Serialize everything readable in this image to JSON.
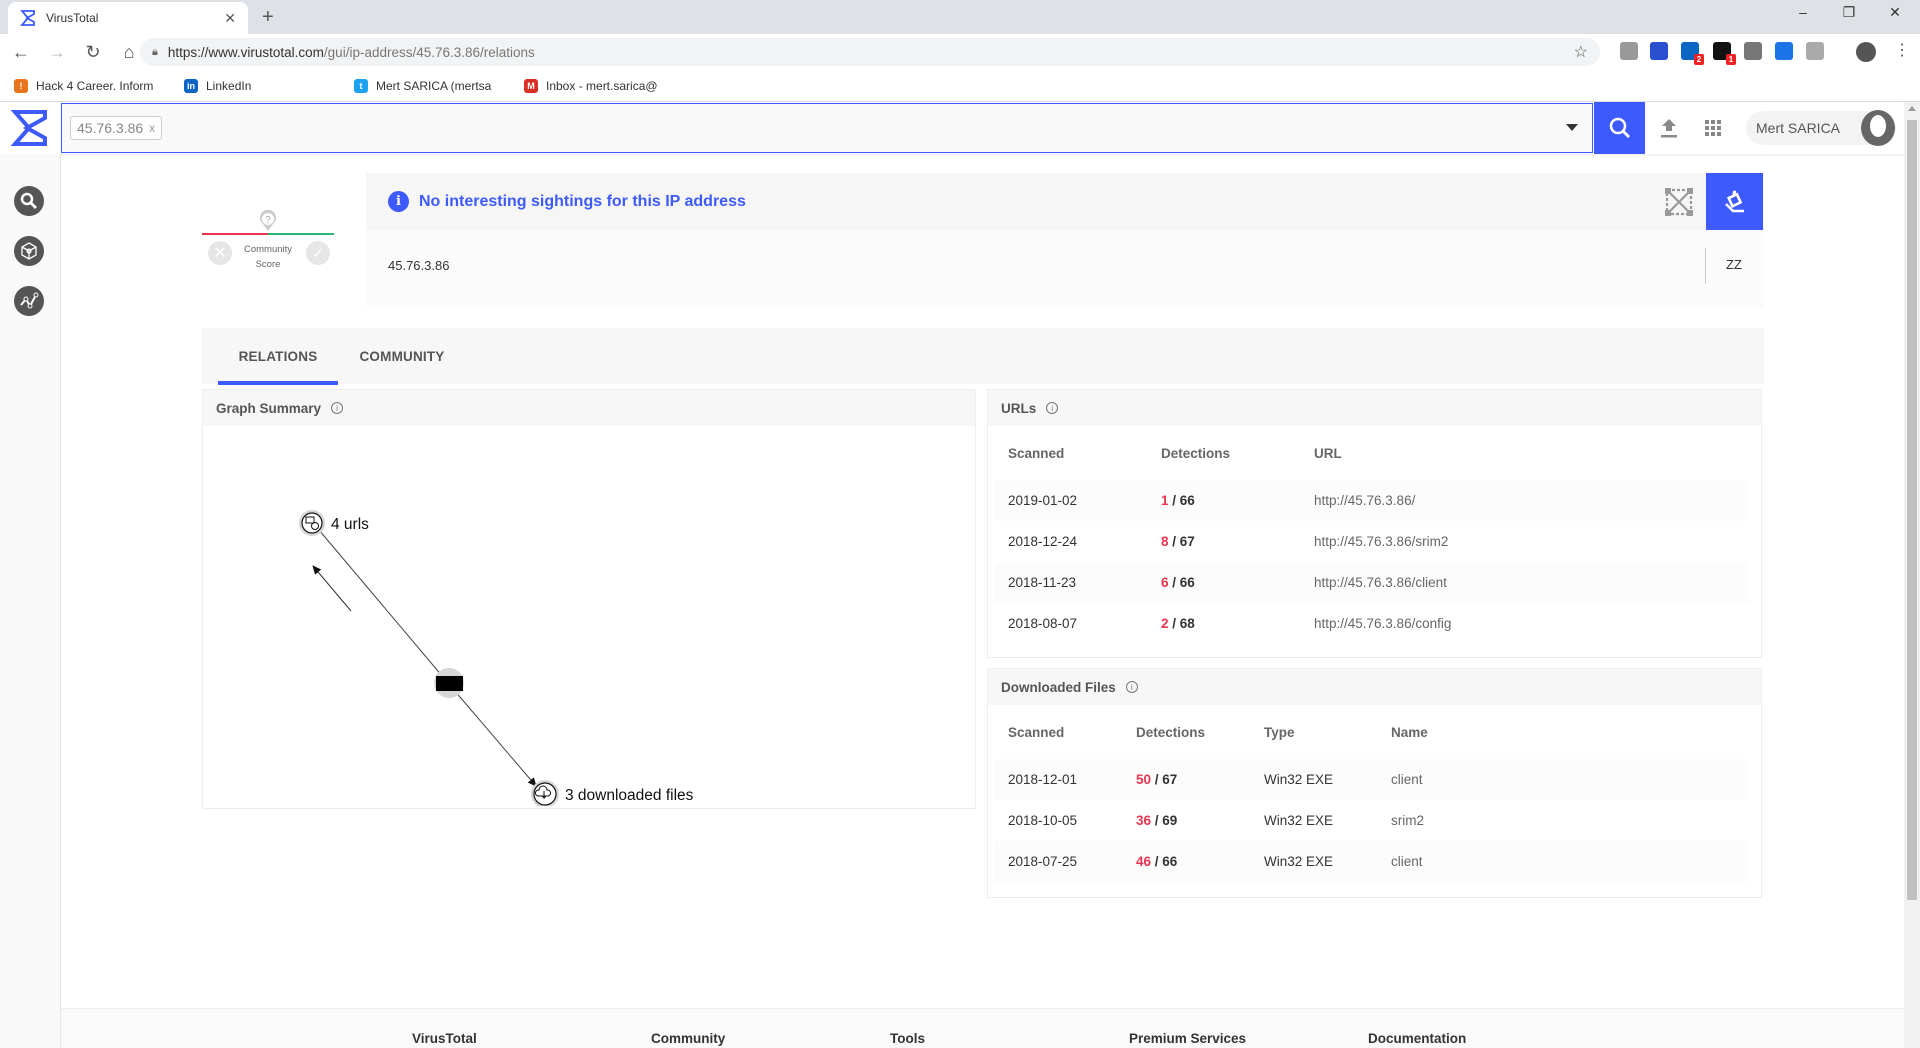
{
  "browser": {
    "tab_title": "VirusTotal",
    "new_tab": "+",
    "window_controls": {
      "minimize": "–",
      "maximize": "❐",
      "close": "✕"
    },
    "url_host": "https://www.virustotal.com",
    "url_path": "/gui/ip-address/45.76.3.86/relations",
    "extensions": [
      {
        "name": "globe",
        "color": "#999999",
        "badge": ""
      },
      {
        "name": "block",
        "color": "#2a4fd0",
        "badge": ""
      },
      {
        "name": "linkedin",
        "color": "#0a66c2",
        "badge": "2"
      },
      {
        "name": "dark",
        "color": "#111111",
        "badge": "1"
      },
      {
        "name": "s",
        "color": "#777777",
        "badge": ""
      },
      {
        "name": "arrow",
        "color": "#1a73e8",
        "badge": ""
      },
      {
        "name": "shield",
        "color": "#aaaaaa",
        "badge": ""
      }
    ],
    "bookmarks": [
      {
        "label": "Hack 4 Career. Inform",
        "icon": "h4c-icon",
        "color": "#e8741c",
        "glyph": "!"
      },
      {
        "label": "LinkedIn",
        "icon": "linkedin-icon",
        "color": "#0a66c2",
        "glyph": "in"
      },
      {
        "label": "Mert SARICA (mertsa",
        "icon": "twitter-icon",
        "color": "#1da1f2",
        "glyph": "t"
      },
      {
        "label": "Inbox - mert.sarica@",
        "icon": "gmail-icon",
        "color": "#d93025",
        "glyph": "M"
      }
    ]
  },
  "header": {
    "search_chip": "45.76.3.86",
    "chip_close": "x",
    "user_name": "Mert SARICA"
  },
  "summary": {
    "community_score_label_1": "Community",
    "community_score_label_2": "Score",
    "message": "No interesting sightings for this IP address",
    "ip": "45.76.3.86",
    "tag": "ZZ"
  },
  "tabs": [
    {
      "label": "RELATIONS",
      "active": true
    },
    {
      "label": "COMMUNITY",
      "active": false
    }
  ],
  "graph": {
    "title": "Graph Summary",
    "nodes": [
      {
        "id": "urls",
        "label": "4 urls"
      },
      {
        "id": "files",
        "label": "3 downloaded files"
      }
    ]
  },
  "urls": {
    "title": "URLs",
    "columns": [
      "Scanned",
      "Detections",
      "URL"
    ],
    "rows": [
      {
        "scanned": "2019-01-02",
        "positives": "1",
        "total": "66",
        "url": "http://45.76.3.86/"
      },
      {
        "scanned": "2018-12-24",
        "positives": "8",
        "total": "67",
        "url": "http://45.76.3.86/srim2"
      },
      {
        "scanned": "2018-11-23",
        "positives": "6",
        "total": "66",
        "url": "http://45.76.3.86/client"
      },
      {
        "scanned": "2018-08-07",
        "positives": "2",
        "total": "68",
        "url": "http://45.76.3.86/config"
      }
    ]
  },
  "files": {
    "title": "Downloaded Files",
    "columns": [
      "Scanned",
      "Detections",
      "Type",
      "Name"
    ],
    "rows": [
      {
        "scanned": "2018-12-01",
        "positives": "50",
        "total": "67",
        "type": "Win32 EXE",
        "name": "client"
      },
      {
        "scanned": "2018-10-05",
        "positives": "36",
        "total": "69",
        "type": "Win32 EXE",
        "name": "srim2"
      },
      {
        "scanned": "2018-07-25",
        "positives": "46",
        "total": "66",
        "type": "Win32 EXE",
        "name": "client"
      }
    ]
  },
  "footer": [
    "VirusTotal",
    "Community",
    "Tools",
    "Premium Services",
    "Documentation"
  ],
  "colors": {
    "accent": "#3d5afe",
    "malicious": "#e8344e",
    "harmless": "#2bb673"
  }
}
